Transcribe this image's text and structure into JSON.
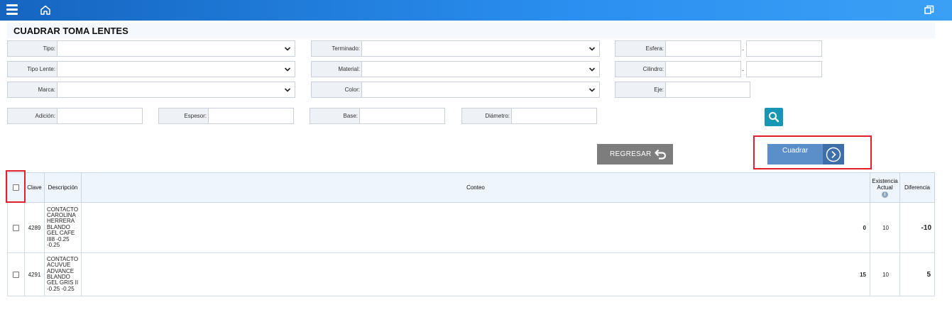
{
  "topbar": {
    "menu_icon": "hamburger-menu-icon",
    "home_icon": "home-icon",
    "restore_icon": "window-restore-icon",
    "accent": "#1e88e5"
  },
  "page": {
    "title": "CUADRAR TOMA LENTES"
  },
  "filters": {
    "tipo": {
      "label": "Tipo:",
      "value": ""
    },
    "terminado": {
      "label": "Terminado:",
      "value": ""
    },
    "esfera": {
      "label": "Esfera:",
      "from": "",
      "to": "",
      "separator": "-"
    },
    "tipo_lente": {
      "label": "Tipo Lente:",
      "value": ""
    },
    "material": {
      "label": "Material:",
      "value": ""
    },
    "cilindro": {
      "label": "Cilindro:",
      "from": "",
      "to": "",
      "separator": "-"
    },
    "marca": {
      "label": "Marca:",
      "value": ""
    },
    "color": {
      "label": "Color:",
      "value": ""
    },
    "eje": {
      "label": "Eje:",
      "value": ""
    },
    "adicion": {
      "label": "Adición:",
      "value": ""
    },
    "espesor": {
      "label": "Espesor:",
      "value": ""
    },
    "base": {
      "label": "Base:",
      "value": ""
    },
    "diametro": {
      "label": "Diámetro:",
      "value": ""
    }
  },
  "actions": {
    "search_icon": "search-icon",
    "regresar_label": "REGRESAR",
    "regresar_icon": "undo-arrow-icon",
    "regresar_color": "#7d7d7d",
    "cuadrar_label": "Cuadrar",
    "cuadrar_icon": "chevron-right-circle-icon",
    "cuadrar_color": "#5a8fc9",
    "highlight_color": "#e0202a"
  },
  "table": {
    "headers": {
      "clave": "Clave",
      "descripcion": "Descripción",
      "conteo": "Conteo",
      "existencia": "Existencia Actual",
      "existencia_info_icon": "info-icon",
      "diferencia": "Diferencia"
    },
    "rows": [
      {
        "clave": "4289",
        "descripcion": "CONTACTO CAROLINA HERRERA BLANDO GEL CAFE III8 -0.25 -0.25",
        "conteo": "0",
        "existencia": "10",
        "diferencia": "-10"
      },
      {
        "clave": "4291",
        "descripcion": "CONTACTO ACUVUE ADVANCE BLANDO GEL GRIS II -0.25 -0.25",
        "conteo": "15",
        "existencia": "10",
        "diferencia": "5"
      }
    ]
  }
}
